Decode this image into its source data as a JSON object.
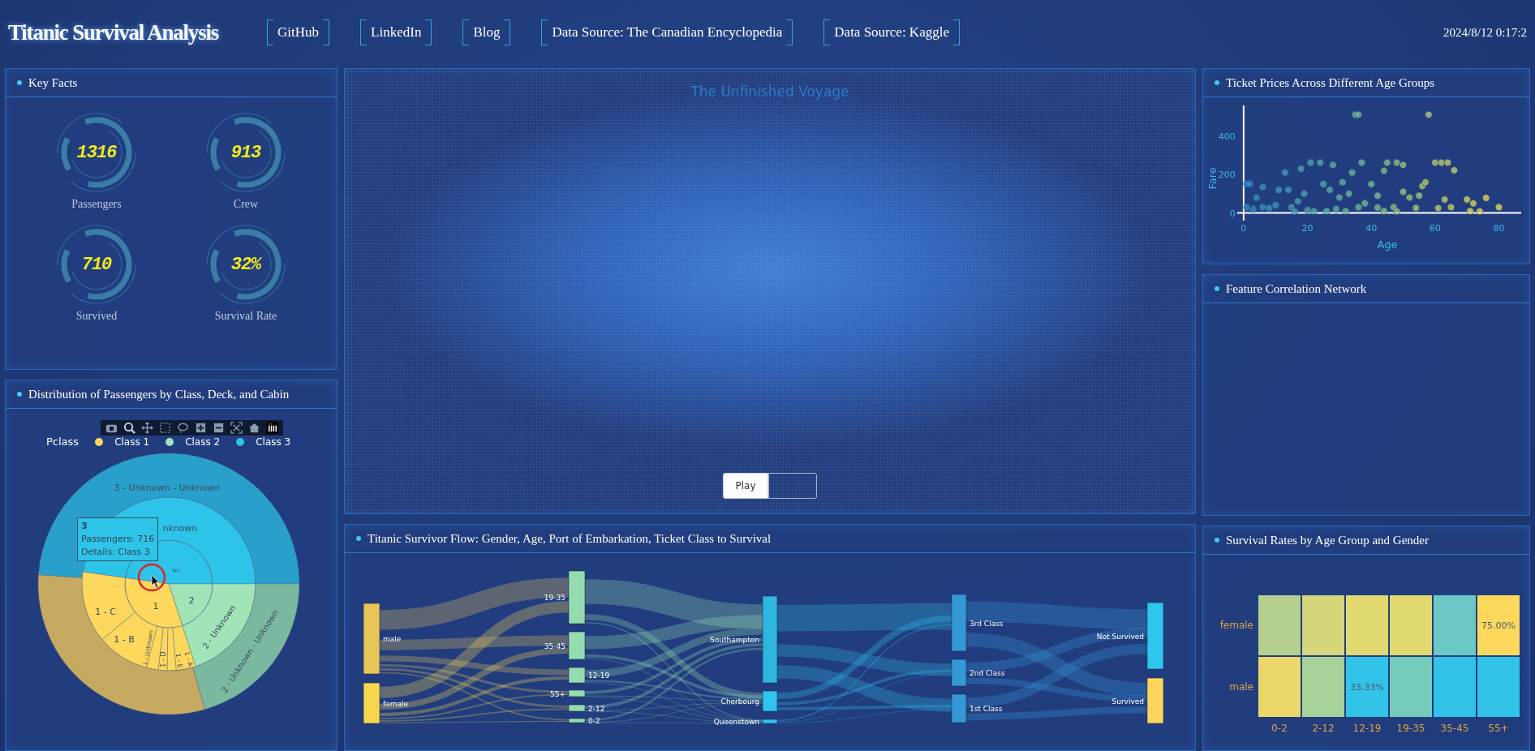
{
  "header": {
    "title": "Titanic Survival Analysis",
    "links": [
      {
        "label": "GitHub"
      },
      {
        "label": "LinkedIn"
      },
      {
        "label": "Blog"
      },
      {
        "label": "Data Source: The Canadian Encyclopedia"
      },
      {
        "label": "Data Source: Kaggle"
      }
    ],
    "datetime": "2024/8/12 0:17:2"
  },
  "key_facts": {
    "title": "Key Facts",
    "stats": [
      {
        "value": "1316",
        "label": "Passengers"
      },
      {
        "value": "913",
        "label": "Crew"
      },
      {
        "value": "710",
        "label": "Survived"
      },
      {
        "value": "32%",
        "label": "Survival Rate"
      }
    ]
  },
  "class_distribution": {
    "title": "Distribution of Passengers by Class, Deck, and Cabin",
    "legend": {
      "title": "Pclass",
      "items": [
        {
          "label": "Class 1",
          "color": "#fdd85d"
        },
        {
          "label": "Class 2",
          "color": "#a0e4b8"
        },
        {
          "label": "Class 3",
          "color": "#2ec3e8"
        }
      ]
    },
    "segments": [
      {
        "label": "3 - Unknown - Unknown"
      },
      {
        "label": "nknown"
      },
      {
        "label": "3"
      },
      {
        "label": "1"
      },
      {
        "label": "2"
      },
      {
        "label": "1 - C"
      },
      {
        "label": "1 - B"
      },
      {
        "label": "1 - Unknown"
      },
      {
        "label": "1 - D"
      },
      {
        "label": "1 - E"
      },
      {
        "label": "1 - A"
      },
      {
        "label": "2 - Unknown"
      },
      {
        "label": "2 - Unknown - Unknown"
      }
    ],
    "tooltip": {
      "title": "3",
      "lines": [
        "Passengers: 716",
        "Details: Class 3"
      ]
    }
  },
  "voyage": {
    "title": "The Unfinished Voyage",
    "controls": [
      {
        "kind": "button",
        "label": "Play"
      },
      {
        "kind": "blank_button"
      }
    ]
  },
  "sankey": {
    "title": "Titanic Survivor Flow: Gender, Age, Port of Embarkation, Ticket Class to Survival",
    "stages": [
      {
        "nodes": [
          {
            "label": "male",
            "color": "#e8c558"
          },
          {
            "label": "female",
            "color": "#f7d64f"
          }
        ]
      },
      {
        "nodes": [
          {
            "label": "19-35",
            "color": "#94dcae"
          },
          {
            "label": "35-45",
            "color": "#94dcae"
          },
          {
            "label": "12-19",
            "color": "#94dcae"
          },
          {
            "label": "55+",
            "color": "#94dcae"
          },
          {
            "label": "2-12",
            "color": "#94dcae"
          },
          {
            "label": "0-2",
            "color": "#94dcae"
          }
        ]
      },
      {
        "nodes": [
          {
            "label": "Southampton",
            "color": "#2eb6de"
          },
          {
            "label": "Cherbourg",
            "color": "#2fc4ee"
          },
          {
            "label": "Queenstown",
            "color": "#2fc4ee"
          }
        ]
      },
      {
        "nodes": [
          {
            "label": "3rd Class",
            "color": "#3599d6"
          },
          {
            "label": "2nd Class",
            "color": "#3599d6"
          },
          {
            "label": "1st Class",
            "color": "#3599d6"
          }
        ]
      },
      {
        "nodes": [
          {
            "label": "Not Survived",
            "color": "#2ec6ec"
          },
          {
            "label": "Survived",
            "color": "#fcd55a"
          }
        ]
      }
    ]
  },
  "ticket_prices": {
    "title": "Ticket Prices Across Different Age Groups",
    "chart_data": {
      "type": "scatter",
      "xlabel": "Age",
      "ylabel": "Fare",
      "xticks": [
        0,
        20,
        40,
        60,
        80
      ],
      "yticks": [
        0,
        200,
        400
      ],
      "xlim": [
        -2,
        87
      ],
      "ylim": [
        -40,
        560
      ],
      "x": [
        0.9,
        2,
        1,
        3,
        4,
        6,
        6,
        8,
        10,
        11,
        13,
        14,
        15,
        17,
        18,
        19,
        21,
        22,
        24,
        25,
        27,
        28,
        29,
        30,
        31,
        33,
        35,
        36,
        34,
        37,
        38,
        40,
        42,
        44,
        45,
        47,
        48,
        50,
        50,
        52,
        55,
        56,
        57,
        58,
        60,
        62,
        63,
        64,
        65,
        66,
        70,
        71,
        72,
        74,
        76,
        80,
        26,
        32,
        44,
        20,
        16,
        36,
        42,
        54,
        61,
        48
      ],
      "series": [
        {
          "values": [
            151,
            151,
            30,
            20,
            80,
            135,
            30,
            25,
            40,
            120,
            210,
            120,
            30,
            60,
            230,
            100,
            262,
            10,
            262,
            150,
            120,
            250,
            20,
            80,
            160,
            100,
            512,
            512,
            210,
            262,
            50,
            150,
            90,
            220,
            262,
            30,
            262,
            250,
            110,
            80,
            90,
            140,
            160,
            512,
            262,
            262,
            70,
            262,
            30,
            222,
            70,
            10,
            50,
            8,
            78,
            30,
            10,
            10,
            10,
            15,
            8,
            30,
            28,
            26,
            25,
            8
          ]
        }
      ]
    }
  },
  "correlation": {
    "title": "Feature Correlation Network"
  },
  "survival_rates": {
    "title": "Survival Rates by Age Group and Gender",
    "rows": [
      {
        "label": "female",
        "cells": [
          {
            "color": "#b5d08e"
          },
          {
            "color": "#d5d67c"
          },
          {
            "color": "#e2d870"
          },
          {
            "color": "#e2d870"
          },
          {
            "color": "#6cc8c4"
          },
          {
            "color": "#fcd95d",
            "text": "75.00%"
          }
        ]
      },
      {
        "label": "male",
        "cells": [
          {
            "color": "#ecd86a"
          },
          {
            "color": "#a6d198"
          },
          {
            "color": "#32c3e8",
            "text": "33.33%"
          },
          {
            "color": "#74cbbc"
          },
          {
            "color": "#32c3e8"
          },
          {
            "color": "#32c3e8"
          }
        ]
      }
    ],
    "x_axis_labels": [
      "0-2",
      "2-12",
      "12-19",
      "19-35",
      "35-45",
      "55+"
    ]
  }
}
